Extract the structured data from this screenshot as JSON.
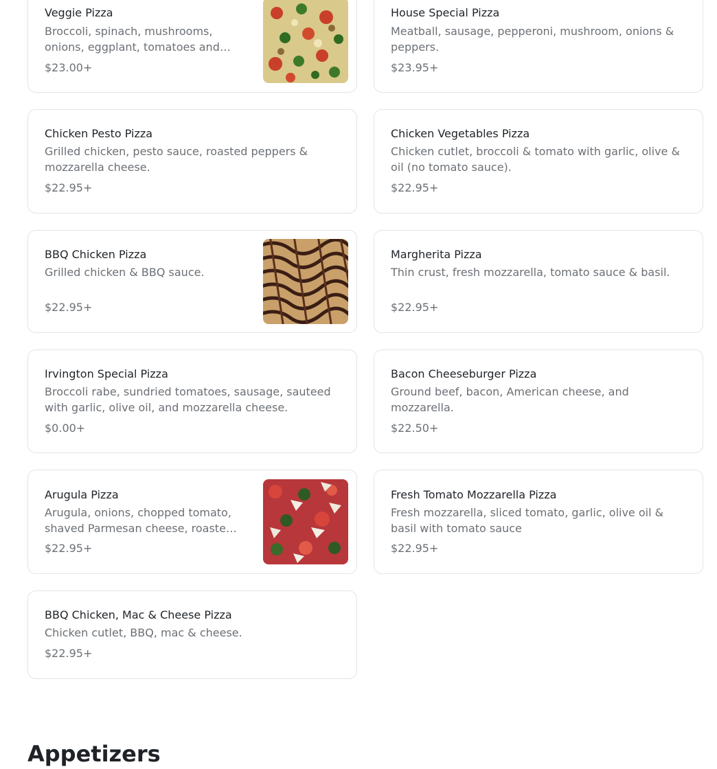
{
  "menu": {
    "items": [
      {
        "name": "Veggie Pizza",
        "description": "Broccoli, spinach, mushrooms, onions, eggplant, tomatoes and…",
        "price": "$23.00+",
        "image": "veggie-pizza-photo"
      },
      {
        "name": "House Special Pizza",
        "description": "Meatball, sausage, pepperoni, mushroom, onions & peppers.",
        "price": "$23.95+"
      },
      {
        "name": "Chicken Pesto Pizza",
        "description": "Grilled chicken, pesto sauce, roasted peppers & mozzarella cheese.",
        "price": "$22.95+"
      },
      {
        "name": "Chicken Vegetables Pizza",
        "description": "Chicken cutlet, broccoli & tomato with garlic, olive & oil (no tomato sauce).",
        "price": "$22.95+"
      },
      {
        "name": "BBQ Chicken Pizza",
        "description": "Grilled chicken & BBQ sauce.",
        "price": "$22.95+",
        "image": "bbq-chicken-pizza-photo"
      },
      {
        "name": "Margherita Pizza",
        "description": "Thin crust, fresh mozzarella, tomato sauce & basil.",
        "price": "$22.95+"
      },
      {
        "name": "Irvington Special Pizza",
        "description": "Broccoli rabe, sundried tomatoes, sausage, sauteed with garlic, olive oil, and mozzarella cheese.",
        "price": "$0.00+"
      },
      {
        "name": "Bacon Cheeseburger Pizza",
        "description": "Ground beef, bacon, American cheese, and mozzarella.",
        "price": "$22.50+"
      },
      {
        "name": "Arugula Pizza",
        "description": "Arugula, onions, chopped tomato, shaved Parmesan cheese, roaste…",
        "price": "$22.95+",
        "image": "arugula-pizza-photo"
      },
      {
        "name": "Fresh Tomato Mozzarella Pizza",
        "description": "Fresh mozzarella, sliced tomato, garlic, olive oil & basil with tomato sauce",
        "price": "$22.95+"
      },
      {
        "name": "BBQ Chicken, Mac & Cheese Pizza",
        "description": "Chicken cutlet, BBQ, mac & cheese.",
        "price": "$22.95+"
      }
    ]
  },
  "next_section": {
    "title": "Appetizers"
  },
  "colors": {
    "border": "#e3e4e6",
    "text": "#1f2328",
    "muted": "#6b7075"
  }
}
